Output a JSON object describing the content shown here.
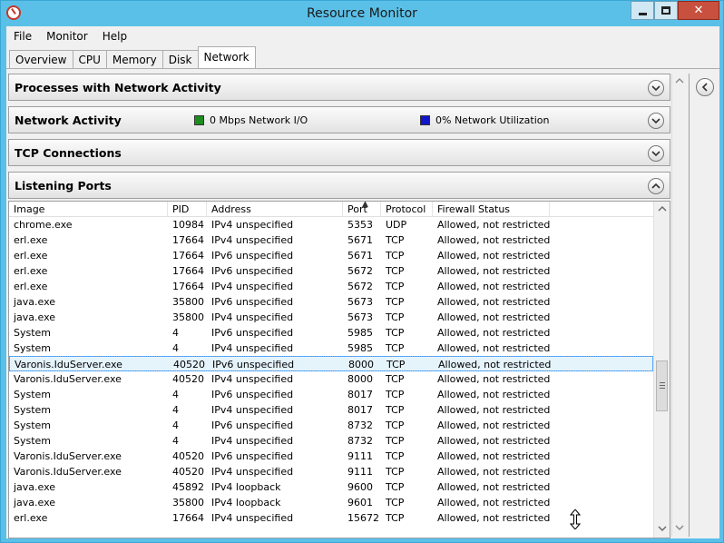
{
  "window": {
    "title": "Resource Monitor"
  },
  "menu": [
    "File",
    "Monitor",
    "Help"
  ],
  "tabs": [
    "Overview",
    "CPU",
    "Memory",
    "Disk",
    "Network"
  ],
  "active_tab": "Network",
  "sections": {
    "processes": {
      "title": "Processes with Network Activity"
    },
    "activity": {
      "title": "Network Activity",
      "io_legend": "0 Mbps Network I/O",
      "util_legend": "0% Network Utilization",
      "io_color": "#1e8c1e",
      "util_color": "#1414c8"
    },
    "tcp": {
      "title": "TCP Connections"
    },
    "listening": {
      "title": "Listening Ports"
    }
  },
  "listening_table": {
    "columns": [
      "Image",
      "PID",
      "Address",
      "Port",
      "Protocol",
      "Firewall Status"
    ],
    "rows": [
      [
        "chrome.exe",
        "10984",
        "IPv4 unspecified",
        "5353",
        "UDP",
        "Allowed, not restricted"
      ],
      [
        "erl.exe",
        "17664",
        "IPv4 unspecified",
        "5671",
        "TCP",
        "Allowed, not restricted"
      ],
      [
        "erl.exe",
        "17664",
        "IPv6 unspecified",
        "5671",
        "TCP",
        "Allowed, not restricted"
      ],
      [
        "erl.exe",
        "17664",
        "IPv6 unspecified",
        "5672",
        "TCP",
        "Allowed, not restricted"
      ],
      [
        "erl.exe",
        "17664",
        "IPv4 unspecified",
        "5672",
        "TCP",
        "Allowed, not restricted"
      ],
      [
        "java.exe",
        "35800",
        "IPv6 unspecified",
        "5673",
        "TCP",
        "Allowed, not restricted"
      ],
      [
        "java.exe",
        "35800",
        "IPv4 unspecified",
        "5673",
        "TCP",
        "Allowed, not restricted"
      ],
      [
        "System",
        "4",
        "IPv6 unspecified",
        "5985",
        "TCP",
        "Allowed, not restricted"
      ],
      [
        "System",
        "4",
        "IPv4 unspecified",
        "5985",
        "TCP",
        "Allowed, not restricted"
      ],
      [
        "Varonis.IduServer.exe",
        "40520",
        "IPv6 unspecified",
        "8000",
        "TCP",
        "Allowed, not restricted"
      ],
      [
        "Varonis.IduServer.exe",
        "40520",
        "IPv4 unspecified",
        "8000",
        "TCP",
        "Allowed, not restricted"
      ],
      [
        "System",
        "4",
        "IPv6 unspecified",
        "8017",
        "TCP",
        "Allowed, not restricted"
      ],
      [
        "System",
        "4",
        "IPv4 unspecified",
        "8017",
        "TCP",
        "Allowed, not restricted"
      ],
      [
        "System",
        "4",
        "IPv6 unspecified",
        "8732",
        "TCP",
        "Allowed, not restricted"
      ],
      [
        "System",
        "4",
        "IPv4 unspecified",
        "8732",
        "TCP",
        "Allowed, not restricted"
      ],
      [
        "Varonis.IduServer.exe",
        "40520",
        "IPv6 unspecified",
        "9111",
        "TCP",
        "Allowed, not restricted"
      ],
      [
        "Varonis.IduServer.exe",
        "40520",
        "IPv4 unspecified",
        "9111",
        "TCP",
        "Allowed, not restricted"
      ],
      [
        "java.exe",
        "45892",
        "IPv4 loopback",
        "9600",
        "TCP",
        "Allowed, not restricted"
      ],
      [
        "java.exe",
        "35800",
        "IPv4 loopback",
        "9601",
        "TCP",
        "Allowed, not restricted"
      ],
      [
        "erl.exe",
        "17664",
        "IPv4 unspecified",
        "15672",
        "TCP",
        "Allowed, not restricted"
      ]
    ],
    "selected_row": 9
  }
}
